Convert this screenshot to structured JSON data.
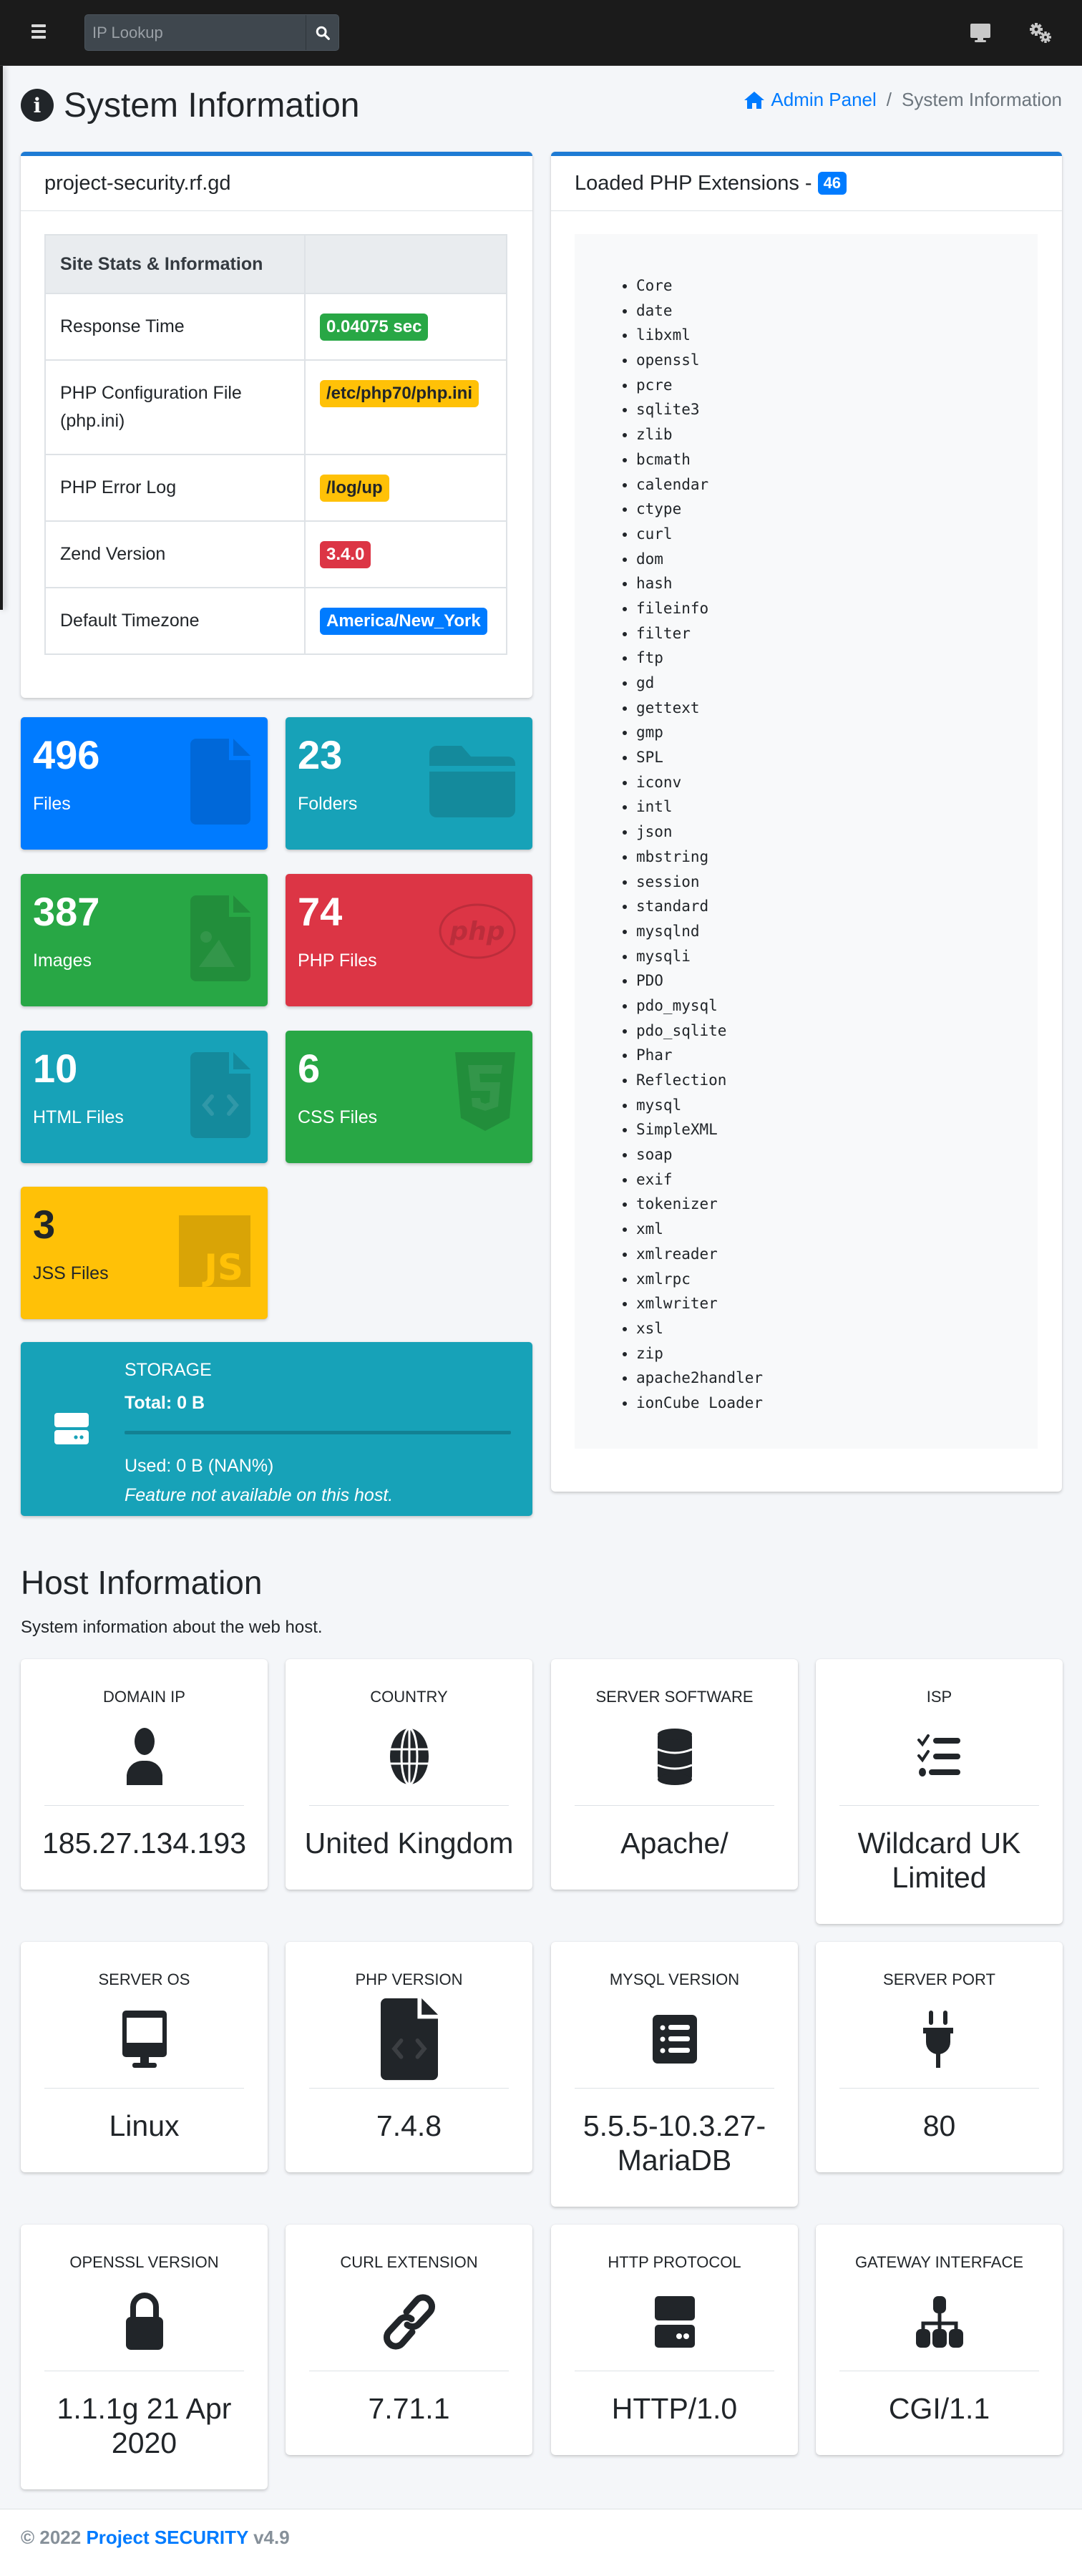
{
  "navbar": {
    "search_placeholder": "IP Lookup",
    "icons": [
      "menu-icon",
      "search-icon",
      "desktop-icon",
      "cogs-icon"
    ]
  },
  "header": {
    "title": "System Information",
    "breadcrumb": {
      "home_label": "Admin Panel",
      "separator": "/",
      "current": "System Information"
    }
  },
  "site_card": {
    "title": "project-security.rf.gd",
    "table_header": "Site Stats & Information",
    "rows": [
      {
        "label": "Response Time",
        "value": "0.04075 sec",
        "badge": "success"
      },
      {
        "label": "PHP Configuration File (php.ini)",
        "value": "/etc/php70/php.ini",
        "badge": "warning"
      },
      {
        "label": "PHP Error Log",
        "value": "/log/up",
        "badge": "warning"
      },
      {
        "label": "Zend Version",
        "value": "3.4.0",
        "badge": "danger"
      },
      {
        "label": "Default Timezone",
        "value": "America/New_York",
        "badge": "primary"
      }
    ]
  },
  "stat_boxes": [
    {
      "count": "496",
      "label": "Files",
      "color": "#007bff",
      "icon": "file-icon"
    },
    {
      "count": "23",
      "label": "Folders",
      "color": "#17a2b8",
      "icon": "folder-icon"
    },
    {
      "count": "387",
      "label": "Images",
      "color": "#28a745",
      "icon": "image-file-icon"
    },
    {
      "count": "74",
      "label": "PHP Files",
      "color": "#dc3545",
      "icon": "php-icon"
    },
    {
      "count": "10",
      "label": "HTML Files",
      "color": "#17a2b8",
      "icon": "code-file-icon"
    },
    {
      "count": "6",
      "label": "CSS Files",
      "color": "#28a745",
      "icon": "css3-icon"
    },
    {
      "count": "3",
      "label": "JSS Files",
      "color": "#ffc107",
      "icon": "js-icon"
    }
  ],
  "storage": {
    "title": "STORAGE",
    "total": "Total: 0 B",
    "used": "Used: 0 B (NAN%)",
    "note": "Feature not available on this host.",
    "used_fraction": 0
  },
  "extensions": {
    "title": "Loaded PHP Extensions -",
    "count": "46",
    "items": [
      "Core",
      "date",
      "libxml",
      "openssl",
      "pcre",
      "sqlite3",
      "zlib",
      "bcmath",
      "calendar",
      "ctype",
      "curl",
      "dom",
      "hash",
      "fileinfo",
      "filter",
      "ftp",
      "gd",
      "gettext",
      "gmp",
      "SPL",
      "iconv",
      "intl",
      "json",
      "mbstring",
      "session",
      "standard",
      "mysqlnd",
      "mysqli",
      "PDO",
      "pdo_mysql",
      "pdo_sqlite",
      "Phar",
      "Reflection",
      "mysql",
      "SimpleXML",
      "soap",
      "exif",
      "tokenizer",
      "xml",
      "xmlreader",
      "xmlrpc",
      "xmlwriter",
      "xsl",
      "zip",
      "apache2handler",
      "ionCube Loader"
    ]
  },
  "host": {
    "title": "Host Information",
    "subtitle": "System information about the web host.",
    "cards": [
      {
        "label": "DOMAIN IP",
        "value": "185.27.134.193",
        "icon": "user-icon"
      },
      {
        "label": "COUNTRY",
        "value": "United Kingdom",
        "icon": "globe-icon"
      },
      {
        "label": "SERVER SOFTWARE",
        "value": "Apache/",
        "icon": "database-icon"
      },
      {
        "label": "ISP",
        "value": "Wildcard UK Limited",
        "icon": "tasks-icon"
      },
      {
        "label": "SERVER OS",
        "value": "Linux",
        "icon": "desktop-icon"
      },
      {
        "label": "PHP VERSION",
        "value": "7.4.8",
        "icon": "code-file-icon"
      },
      {
        "label": "MYSQL VERSION",
        "value": "5.5.5-10.3.27-MariaDB",
        "icon": "list-alt-icon"
      },
      {
        "label": "SERVER PORT",
        "value": "80",
        "icon": "plug-icon"
      },
      {
        "label": "OPENSSL VERSION",
        "value": "1.1.1g 21 Apr 2020",
        "icon": "lock-icon"
      },
      {
        "label": "CURL EXTENSION",
        "value": "7.71.1",
        "icon": "link-icon"
      },
      {
        "label": "HTTP PROTOCOL",
        "value": "HTTP/1.0",
        "icon": "hdd-icon"
      },
      {
        "label": "GATEWAY INTERFACE",
        "value": "CGI/1.1",
        "icon": "sitemap-icon"
      }
    ]
  },
  "footer": {
    "copyright": "© 2022",
    "brand": "Project SECURITY",
    "version": "v4.9"
  }
}
